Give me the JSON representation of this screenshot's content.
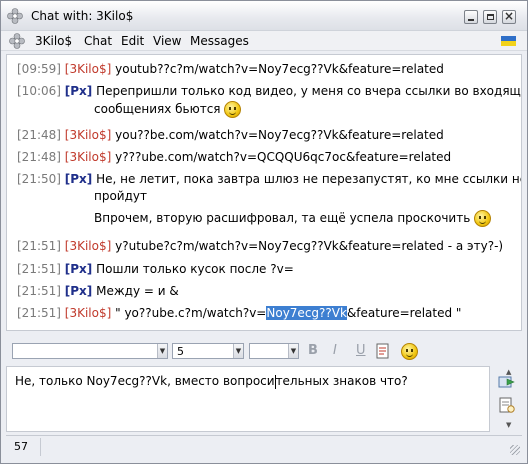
{
  "window": {
    "title": "Chat with: 3Kilo$"
  },
  "menu": {
    "contact": "3Kilo$",
    "items": [
      "Chat",
      "Edit",
      "View",
      "Messages"
    ]
  },
  "icons": {
    "app": "flower-icon",
    "menu": "flower-icon",
    "flag": "ukraine-flag-icon",
    "smiley": "smiley-icon",
    "send": "send-message-icon",
    "history": "history-icon"
  },
  "colors": {
    "timestamp": "#7a7a7a",
    "nick_kilo": "#c0392b",
    "nick_px": "#1f2f8a",
    "highlight": "#3d7fd1"
  },
  "messages": [
    {
      "time": "[09:59]",
      "nick": "[3Kilo$]",
      "text": "youtub??c?m/watch?v=Noy7ecg??Vk&feature=related"
    },
    {
      "time": "[10:06]",
      "nick": "[Px]",
      "text": "Перепришли только код видео, у меня со вчера ссылки во входящих",
      "cont": "сообщениях бьются"
    },
    {
      "time": "[21:48]",
      "nick": "[3Kilo$]",
      "text": "you??be.com/watch?v=Noy7ecg??Vk&feature=related"
    },
    {
      "time": "[21:48]",
      "nick": "[3Kilo$]",
      "text": "y???ube.com/watch?v=QCQQU6qc7oc&feature=related"
    },
    {
      "time": "[21:50]",
      "nick": "[Px]",
      "text": "Не, не летит, пока завтра шлюз не перезапустят, ко мне ссылки не",
      "cont": "пройдут",
      "extra": "Впрочем, вторую расшифровал, та ещё успела проскочить"
    },
    {
      "time": "[21:51]",
      "nick": "[3Kilo$]",
      "text": "y?utube?c?m/watch?v=Noy7ecg??Vk&feature=related - а эту?-)"
    },
    {
      "time": "[21:51]",
      "nick": "[Px]",
      "text": "Пошли только кусок после ?v="
    },
    {
      "time": "[21:51]",
      "nick": "[Px]",
      "text": "Между = и &"
    },
    {
      "time": "[21:51]",
      "nick": "[3Kilo$]",
      "text_before": "\" yo??ube.c?m/watch?v=",
      "text_hl": "Noy7ecg??Vk",
      "text_after": "&feature=related \""
    }
  ],
  "format": {
    "font_value": "",
    "size_value": "5",
    "color_value": "",
    "bold": "B",
    "italic": "I",
    "underline": "U"
  },
  "input": {
    "text_before": "Не, только Noy7ecg??Vk, вместо вопроси",
    "text_after": "тельных знаков что?"
  },
  "status": {
    "char_count": "57"
  }
}
